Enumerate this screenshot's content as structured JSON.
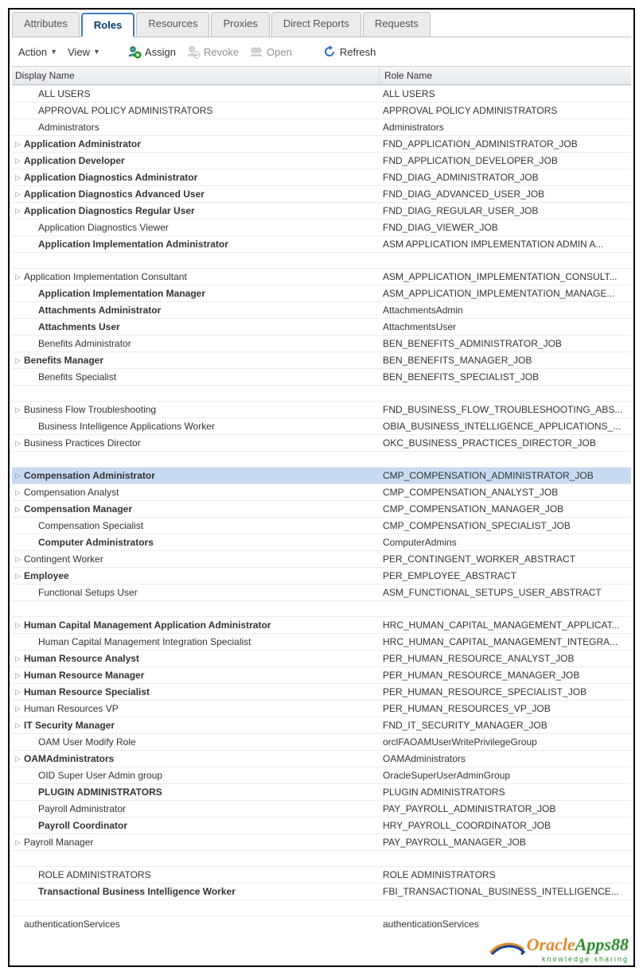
{
  "tabs": [
    {
      "label": "Attributes",
      "active": false
    },
    {
      "label": "Roles",
      "active": true
    },
    {
      "label": "Resources",
      "active": false
    },
    {
      "label": "Proxies",
      "active": false
    },
    {
      "label": "Direct Reports",
      "active": false
    },
    {
      "label": "Requests",
      "active": false
    }
  ],
  "toolbar": {
    "action": "Action",
    "view": "View",
    "assign": "Assign",
    "revoke": "Revoke",
    "open": "Open",
    "refresh": "Refresh"
  },
  "headers": {
    "display_name": "Display Name",
    "role_name": "Role Name"
  },
  "rows": [
    {
      "disp": "ALL USERS",
      "role": "ALL USERS",
      "exp": false,
      "bold": false,
      "indent": true
    },
    {
      "disp": "APPROVAL POLICY ADMINISTRATORS",
      "role": "APPROVAL POLICY ADMINISTRATORS",
      "exp": false,
      "bold": false,
      "indent": true
    },
    {
      "disp": "Administrators",
      "role": "Administrators",
      "exp": false,
      "bold": false,
      "indent": true
    },
    {
      "disp": "Application Administrator",
      "role": "FND_APPLICATION_ADMINISTRATOR_JOB",
      "exp": true,
      "bold": true
    },
    {
      "disp": "Application Developer",
      "role": "FND_APPLICATION_DEVELOPER_JOB",
      "exp": true,
      "bold": true
    },
    {
      "disp": "Application Diagnostics Administrator",
      "role": "FND_DIAG_ADMINISTRATOR_JOB",
      "exp": true,
      "bold": true
    },
    {
      "disp": "Application Diagnostics Advanced User",
      "role": "FND_DIAG_ADVANCED_USER_JOB",
      "exp": true,
      "bold": true
    },
    {
      "disp": "Application Diagnostics Regular User",
      "role": "FND_DIAG_REGULAR_USER_JOB",
      "exp": true,
      "bold": true
    },
    {
      "disp": "Application Diagnostics Viewer",
      "role": "FND_DIAG_VIEWER_JOB",
      "exp": false,
      "bold": false,
      "indent": true
    },
    {
      "disp": "Application Implementation Administrator",
      "role": "ASM APPLICATION IMPLEMENTATION ADMIN A...",
      "exp": false,
      "bold": true,
      "indent": true
    },
    {
      "gap": true
    },
    {
      "disp": "Application Implementation Consultant",
      "role": "ASM_APPLICATION_IMPLEMENTATION_CONSULT...",
      "exp": true,
      "bold": false
    },
    {
      "disp": "Application Implementation Manager",
      "role": "ASM_APPLICATION_IMPLEMENTATION_MANAGE...",
      "exp": false,
      "bold": true,
      "indent": true
    },
    {
      "disp": "Attachments Administrator",
      "role": "AttachmentsAdmin",
      "exp": false,
      "bold": true,
      "indent": true
    },
    {
      "disp": "Attachments User",
      "role": "AttachmentsUser",
      "exp": false,
      "bold": true,
      "indent": true
    },
    {
      "disp": "Benefits Administrator",
      "role": "BEN_BENEFITS_ADMINISTRATOR_JOB",
      "exp": false,
      "bold": false,
      "indent": true
    },
    {
      "disp": "Benefits Manager",
      "role": "BEN_BENEFITS_MANAGER_JOB",
      "exp": true,
      "bold": true
    },
    {
      "disp": "Benefits Specialist",
      "role": "BEN_BENEFITS_SPECIALIST_JOB",
      "exp": false,
      "bold": false,
      "indent": true
    },
    {
      "gap": true
    },
    {
      "disp": "Business Flow Troubleshooting",
      "role": "FND_BUSINESS_FLOW_TROUBLESHOOTING_ABS...",
      "exp": true,
      "bold": false
    },
    {
      "disp": "Business Intelligence Applications Worker",
      "role": "OBIA_BUSINESS_INTELLIGENCE_APPLICATIONS_...",
      "exp": false,
      "bold": false,
      "indent": true
    },
    {
      "disp": "Business Practices Director",
      "role": "OKC_BUSINESS_PRACTICES_DIRECTOR_JOB",
      "exp": true,
      "bold": false
    },
    {
      "gap": true
    },
    {
      "disp": "Compensation Administrator",
      "role": "CMP_COMPENSATION_ADMINISTRATOR_JOB",
      "exp": true,
      "bold": true,
      "selected": true
    },
    {
      "disp": "Compensation Analyst",
      "role": "CMP_COMPENSATION_ANALYST_JOB",
      "exp": true,
      "bold": false
    },
    {
      "disp": "Compensation Manager",
      "role": "CMP_COMPENSATION_MANAGER_JOB",
      "exp": true,
      "bold": true
    },
    {
      "disp": "Compensation Specialist",
      "role": "CMP_COMPENSATION_SPECIALIST_JOB",
      "exp": false,
      "bold": false,
      "indent": true
    },
    {
      "disp": "Computer Administrators",
      "role": "ComputerAdmins",
      "exp": false,
      "bold": true,
      "indent": true
    },
    {
      "disp": "Contingent Worker",
      "role": "PER_CONTINGENT_WORKER_ABSTRACT",
      "exp": true,
      "bold": false
    },
    {
      "disp": "Employee",
      "role": "PER_EMPLOYEE_ABSTRACT",
      "exp": true,
      "bold": true
    },
    {
      "disp": "Functional Setups User",
      "role": "ASM_FUNCTIONAL_SETUPS_USER_ABSTRACT",
      "exp": false,
      "bold": false,
      "indent": true
    },
    {
      "gap": true
    },
    {
      "disp": "Human Capital Management Application Administrator",
      "role": "HRC_HUMAN_CAPITAL_MANAGEMENT_APPLICAT...",
      "exp": true,
      "bold": true
    },
    {
      "disp": "Human Capital Management Integration Specialist",
      "role": "HRC_HUMAN_CAPITAL_MANAGEMENT_INTEGRA...",
      "exp": false,
      "bold": false,
      "indent": true
    },
    {
      "disp": "Human Resource Analyst",
      "role": "PER_HUMAN_RESOURCE_ANALYST_JOB",
      "exp": true,
      "bold": true
    },
    {
      "disp": "Human Resource Manager",
      "role": "PER_HUMAN_RESOURCE_MANAGER_JOB",
      "exp": true,
      "bold": true
    },
    {
      "disp": "Human Resource Specialist",
      "role": "PER_HUMAN_RESOURCE_SPECIALIST_JOB",
      "exp": true,
      "bold": true
    },
    {
      "disp": "Human Resources VP",
      "role": "PER_HUMAN_RESOURCES_VP_JOB",
      "exp": true,
      "bold": false
    },
    {
      "disp": "IT Security Manager",
      "role": "FND_IT_SECURITY_MANAGER_JOB",
      "exp": true,
      "bold": true
    },
    {
      "disp": "OAM User Modify Role",
      "role": "orclFAOAMUserWritePrivilegeGroup",
      "exp": false,
      "bold": false,
      "indent": true
    },
    {
      "disp": "OAMAdministrators",
      "role": "OAMAdministrators",
      "exp": true,
      "bold": true
    },
    {
      "disp": "OID Super User Admin group",
      "role": "OracleSuperUserAdminGroup",
      "exp": false,
      "bold": false,
      "indent": true
    },
    {
      "disp": "PLUGIN ADMINISTRATORS",
      "role": "PLUGIN ADMINISTRATORS",
      "exp": false,
      "bold": true,
      "indent": true
    },
    {
      "disp": "Payroll Administrator",
      "role": "PAY_PAYROLL_ADMINISTRATOR_JOB",
      "exp": false,
      "bold": false,
      "indent": true
    },
    {
      "disp": "Payroll Coordinator",
      "role": "HRY_PAYROLL_COORDINATOR_JOB",
      "exp": false,
      "bold": true,
      "indent": true
    },
    {
      "disp": "Payroll Manager",
      "role": "PAY_PAYROLL_MANAGER_JOB",
      "exp": true,
      "bold": false
    },
    {
      "gap": true
    },
    {
      "disp": "ROLE ADMINISTRATORS",
      "role": "ROLE ADMINISTRATORS",
      "exp": false,
      "bold": false,
      "indent": true
    },
    {
      "disp": "Transactional Business Intelligence Worker",
      "role": "FBI_TRANSACTIONAL_BUSINESS_INTELLIGENCE...",
      "exp": false,
      "bold": true,
      "indent": true
    },
    {
      "gap": true
    },
    {
      "disp": "authenticationServices",
      "role": "authenticationServices",
      "exp": false,
      "bold": false,
      "indent": false,
      "noexp": true
    }
  ],
  "logo": {
    "part1": "Oracle",
    "part2": "Apps88",
    "tagline": "knowledge sharing"
  }
}
